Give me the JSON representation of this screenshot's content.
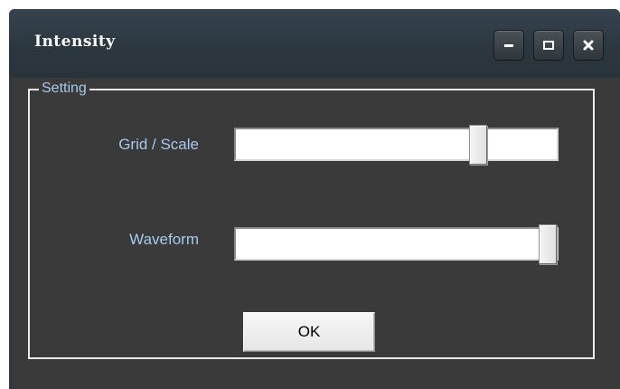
{
  "window": {
    "title": "Intensity"
  },
  "titlebar_buttons": {
    "minimize_icon": "minimize-icon",
    "maximize_icon": "maximize-icon",
    "close_icon": "close-icon"
  },
  "group": {
    "legend": "Setting",
    "sliders": [
      {
        "label": "Grid / Scale",
        "value_fraction": 0.77
      },
      {
        "label": "Waveform",
        "value_fraction": 1.0
      }
    ]
  },
  "ok_button": {
    "label": "OK"
  },
  "colors": {
    "titlebar": "#2e3a42",
    "panel": "#3a3a3a",
    "label_text": "#a8c8ec",
    "title_text": "#ffffff"
  }
}
